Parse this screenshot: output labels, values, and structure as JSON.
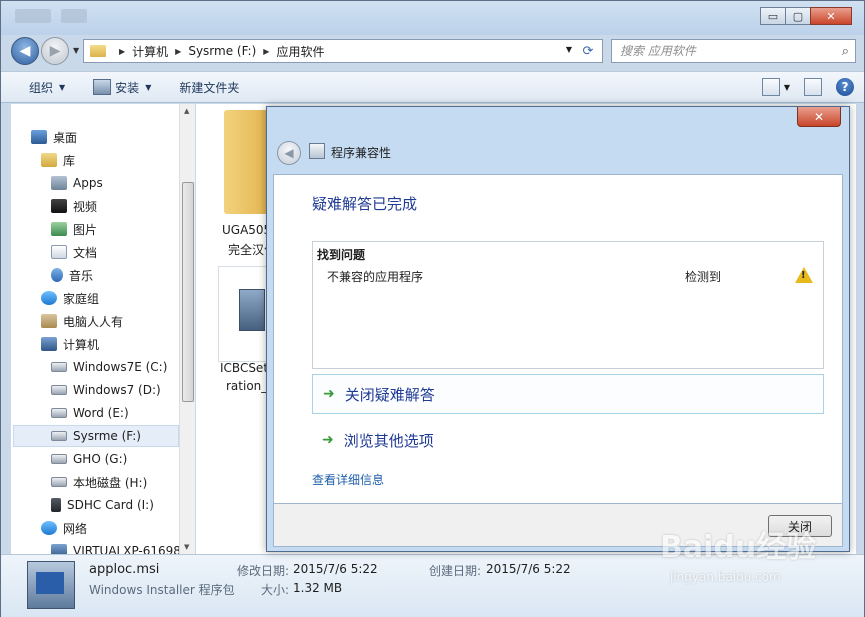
{
  "window": {
    "caption_minimize": "▭",
    "caption_maximize": "▢",
    "caption_close": "✕"
  },
  "address": {
    "parts": [
      "计算机",
      "Sysrme (F:)",
      "应用软件"
    ]
  },
  "search": {
    "placeholder": "搜索 应用软件"
  },
  "toolbar": {
    "organize": "组织",
    "install": "安装",
    "new_folder": "新建文件夹"
  },
  "nav_tree": [
    {
      "label": "桌面",
      "icon": "desktop-icon"
    },
    {
      "label": "库",
      "icon": "library-icon"
    },
    {
      "label": "Apps",
      "icon": "apps-icon"
    },
    {
      "label": "视频",
      "icon": "video-icon"
    },
    {
      "label": "图片",
      "icon": "picture-icon"
    },
    {
      "label": "文档",
      "icon": "document-icon"
    },
    {
      "label": "音乐",
      "icon": "music-icon"
    },
    {
      "label": "家庭组",
      "icon": "homegroup-icon"
    },
    {
      "label": "电脑人人有",
      "icon": "user-folder-icon"
    },
    {
      "label": "计算机",
      "icon": "computer-icon"
    },
    {
      "label": "Windows7E (C:)",
      "icon": "drive-icon"
    },
    {
      "label": "Windows7 (D:)",
      "icon": "drive-icon"
    },
    {
      "label": "Word (E:)",
      "icon": "drive-icon"
    },
    {
      "label": "Sysrme (F:)",
      "icon": "drive-icon"
    },
    {
      "label": "GHO (G:)",
      "icon": "drive-icon"
    },
    {
      "label": "本地磁盘 (H:)",
      "icon": "drive-icon"
    },
    {
      "label": "SDHC Card (I:)",
      "icon": "sd-card-icon"
    },
    {
      "label": "网络",
      "icon": "network-icon"
    },
    {
      "label": "VIRTUALXP-61698",
      "icon": "computer-icon"
    }
  ],
  "files": {
    "folder_label_1": "UGA505",
    "folder_label_2": "完全汉化",
    "msi_label_1": "ICBCSet",
    "msi_label_2": "ration_"
  },
  "details": {
    "name": "apploc.msi",
    "type": "Windows Installer 程序包",
    "modified_key": "修改日期:",
    "modified_val": "2015/7/6 5:22",
    "size_key": "大小:",
    "size_val": "1.32 MB",
    "created_key": "创建日期:",
    "created_val": "2015/7/6 5:22"
  },
  "dialog": {
    "close_x": "✕",
    "title": "程序兼容性",
    "heading": "疑难解答已完成",
    "problems_header": "找到问题",
    "problem_name": "不兼容的应用程序",
    "problem_status": "检测到",
    "link_close": "关闭疑难解答",
    "link_browse": "浏览其他选项",
    "details_link": "查看详细信息",
    "close_button": "关闭"
  },
  "watermark": {
    "main": "Baidu经验",
    "sub": "jingyan.baidu.com"
  }
}
